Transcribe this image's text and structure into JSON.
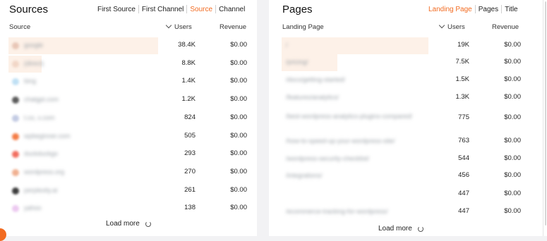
{
  "sources": {
    "title": "Sources",
    "tabs": [
      {
        "label": "First Source",
        "active": false
      },
      {
        "label": "First Channel",
        "active": false
      },
      {
        "label": "Source",
        "active": true
      },
      {
        "label": "Channel",
        "active": false
      }
    ],
    "columns": {
      "name": "Source",
      "users": "Users",
      "revenue": "Revenue"
    },
    "rows": [
      {
        "name": "google",
        "users": "38.4K",
        "revenue": "$0.00",
        "share": 1.0,
        "icon_color": "#e8c6b6"
      },
      {
        "name": "(direct)",
        "users": "8.8K",
        "revenue": "$0.00",
        "share": 0.22,
        "icon_color": "#f1d6c6"
      },
      {
        "name": "bing",
        "users": "1.4K",
        "revenue": "$0.00",
        "share": 0.0,
        "icon_color": "#bfe0f4"
      },
      {
        "name": "chatgpt.com",
        "users": "1.2K",
        "revenue": "$0.00",
        "share": 0.0,
        "icon_color": "#5a5a5a"
      },
      {
        "name": "t.co, x.com",
        "users": "824",
        "revenue": "$0.00",
        "share": 0.0,
        "icon_color": "#c3cbe3"
      },
      {
        "name": "wpbeginner.com",
        "users": "505",
        "revenue": "$0.00",
        "share": 0.0,
        "icon_color": "#f47c45"
      },
      {
        "name": "duckduckgo",
        "users": "293",
        "revenue": "$0.00",
        "share": 0.0,
        "icon_color": "#f26e5f"
      },
      {
        "name": "wordpress.org",
        "users": "270",
        "revenue": "$0.00",
        "share": 0.0,
        "icon_color": "#f0b090"
      },
      {
        "name": "perplexity.ai",
        "users": "261",
        "revenue": "$0.00",
        "share": 0.0,
        "icon_color": "#3b3b3b"
      },
      {
        "name": "yahoo",
        "users": "138",
        "revenue": "$0.00",
        "share": 0.0,
        "icon_color": "#ecc9f0"
      }
    ],
    "load_more": "Load more"
  },
  "pages": {
    "title": "Pages",
    "tabs": [
      {
        "label": "Landing Page",
        "active": true
      },
      {
        "label": "Pages",
        "active": false
      },
      {
        "label": "Title",
        "active": false
      }
    ],
    "columns": {
      "name": "Landing Page",
      "users": "Users",
      "revenue": "Revenue"
    },
    "rows": [
      {
        "name": "/",
        "users": "19K",
        "revenue": "$0.00",
        "share": 1.0
      },
      {
        "name": "/pricing/",
        "users": "7.5K",
        "revenue": "$0.00",
        "share": 0.38
      },
      {
        "name": "/docs/getting-started/",
        "users": "1.5K",
        "revenue": "$0.00",
        "share": 0.0
      },
      {
        "name": "/features/analytics/",
        "users": "1.3K",
        "revenue": "$0.00",
        "share": 0.0
      },
      {
        "name": "/best-wordpress-analytics-plugins-compared/",
        "users": "775",
        "revenue": "$0.00",
        "share": 0.0
      },
      {
        "name": "/how-to-speed-up-your-wordpress-site/",
        "users": "763",
        "revenue": "$0.00",
        "share": 0.0
      },
      {
        "name": "/wordpress-security-checklist/",
        "users": "544",
        "revenue": "$0.00",
        "share": 0.0
      },
      {
        "name": "/integrations/",
        "users": "456",
        "revenue": "$0.00",
        "share": 0.0
      },
      {
        "name": "",
        "users": "447",
        "revenue": "$0.00",
        "share": 0.0
      },
      {
        "name": "/ecommerce-tracking-for-wordpress/",
        "users": "447",
        "revenue": "$0.00",
        "share": 0.0
      }
    ],
    "load_more": "Load more"
  },
  "colors": {
    "accent": "#f26b21",
    "bar": "#fdf1e8"
  }
}
